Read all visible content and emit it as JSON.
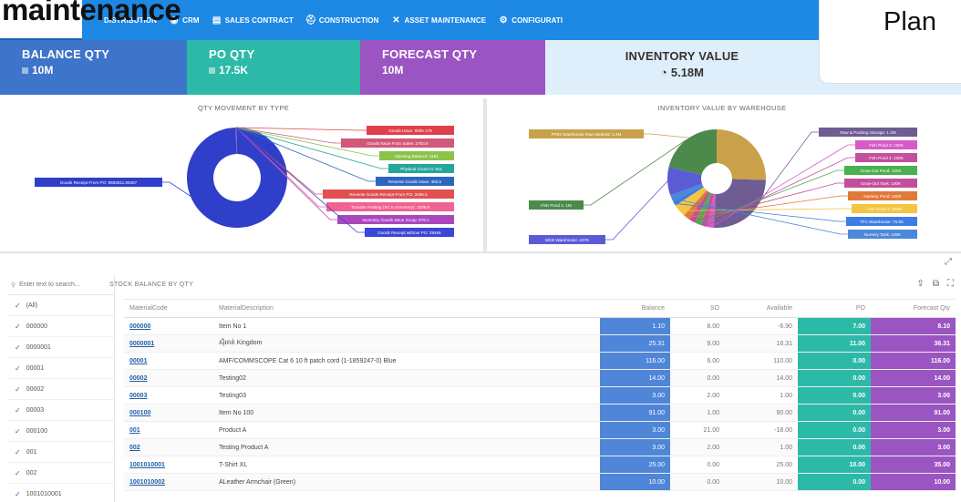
{
  "page_heading": "maintenance",
  "top_right_label": "Plan",
  "nav": {
    "items": [
      {
        "label": "DISTRIBUTION",
        "icon": "distribution-icon",
        "glyph": ""
      },
      {
        "label": "CRM",
        "icon": "crm-icon",
        "glyph": "◉"
      },
      {
        "label": "SALES CONTRACT",
        "icon": "document-icon",
        "glyph": "▤"
      },
      {
        "label": "CONSTRUCTION",
        "icon": "construction-worker-icon",
        "glyph": "⛑"
      },
      {
        "label": "ASSET MAINTENANCE",
        "icon": "tools-icon",
        "glyph": "✕"
      },
      {
        "label": "CONFIGURATI",
        "icon": "gears-icon",
        "glyph": "⚙"
      }
    ]
  },
  "kpis": {
    "balance": {
      "label": "BALANCE QTY",
      "value": "10M"
    },
    "po": {
      "label": "PO QTY",
      "value": "17.5K"
    },
    "forecast": {
      "label": "FORECAST QTY",
      "value": "10M"
    },
    "inventory": {
      "label": "INVENTORY VALUE",
      "value": "5.18M",
      "glyph": "◔"
    }
  },
  "charts": {
    "left_title": "QTY MOVEMENT BY TYPE",
    "right_title": "INVENTORY VALUE BY WAREHOUSE"
  },
  "chart_data": [
    {
      "type": "pie",
      "title": "QTY MOVEMENT BY TYPE",
      "slices": [
        {
          "label": "Goods Receipt From PO: 9992811.99367",
          "value": 9992811.99367,
          "color": "#2f3fc9"
        },
        {
          "label": "Goods Issue: 9005.179",
          "value": 9005.179,
          "color": "#e0404a"
        },
        {
          "label": "Goods Issue From Sales: 2753.9",
          "value": 2753.9,
          "color": "#d2587a"
        },
        {
          "label": "Opening Balance: 1181",
          "value": 1181,
          "color": "#8bc34a"
        },
        {
          "label": "Physical Count In: 911",
          "value": 911,
          "color": "#26a69a"
        },
        {
          "label": "Reverse Goods Issue: 455.5",
          "value": 455.5,
          "color": "#2e65c0"
        },
        {
          "label": "Reverse Goods Receipt From PO: 2056.5",
          "value": 2056.5,
          "color": "#e25050"
        },
        {
          "label": "Transfer Posting (SC In Inventory): 1009.8",
          "value": 1009.8,
          "color": "#f06292"
        },
        {
          "label": "Inventory Goods Issue Scrap: 679.1",
          "value": 679.1,
          "color": "#ab47bc"
        },
        {
          "label": "Goods Receipt without PO: 25465",
          "value": 25465,
          "color": "#3b46d6"
        }
      ]
    },
    {
      "type": "pie",
      "title": "INVENTORY VALUE BY WAREHOUSE",
      "slices": [
        {
          "label": "PP02 Warehouse Raw Material: 1.2M",
          "value": 1200000,
          "color": "#c9a14a"
        },
        {
          "label": "Raw & Packing Storage: 1.2M",
          "value": 1200000,
          "color": "#6e5c93"
        },
        {
          "label": "Fish Pond 3: 100K",
          "value": 100000,
          "color": "#d65ac8"
        },
        {
          "label": "Fish Pond 4: 100K",
          "value": 100000,
          "color": "#c24fa0"
        },
        {
          "label": "Grow-Out Pond: 100K",
          "value": 100000,
          "color": "#4caf50"
        },
        {
          "label": "Grow-Out Tank: 100K",
          "value": 100000,
          "color": "#c24f9b"
        },
        {
          "label": "Nursery Pond: 100K",
          "value": 100000,
          "color": "#e07a3a"
        },
        {
          "label": "Fish Pond 2: 200K",
          "value": 200000,
          "color": "#f4c542"
        },
        {
          "label": "TFC Warehouse: 75.6K",
          "value": 75600,
          "color": "#3b7de0"
        },
        {
          "label": "Nursery Tank: 100K",
          "value": 100000,
          "color": "#4a88d8"
        },
        {
          "label": "MCB Warehouse: 437K",
          "value": 437000,
          "color": "#5b5bd6"
        },
        {
          "label": "Fish Pond 1: 1M",
          "value": 1000000,
          "color": "#4b8a4b"
        }
      ]
    }
  ],
  "sidebar": {
    "search_placeholder": "Enter text to search...",
    "items": [
      "(All)",
      "000000",
      "0000001",
      "00001",
      "00002",
      "00003",
      "000100",
      "001",
      "002",
      "1001010001"
    ]
  },
  "table": {
    "title": "STOCK BALANCE BY QTY",
    "columns": [
      "MaterialCode",
      "MaterialDescription",
      "Balance",
      "SO",
      "Available",
      "PO",
      "Forecast Qty"
    ],
    "rows": [
      {
        "code": "000000",
        "desc": "Item No 1",
        "balance": "1.10",
        "so": "8.00",
        "available": "-6.90",
        "po": "7.00",
        "forecast": "8.10"
      },
      {
        "code": "0000001",
        "desc": "ស៊ុំអាត់ Kingdom",
        "balance": "25.31",
        "so": "9.00",
        "available": "16.31",
        "po": "11.00",
        "forecast": "36.31"
      },
      {
        "code": "00001",
        "desc": "AMF/COMMSCOPE Cat 6 10 ft patch cord (1-1859247-0) Blue",
        "balance": "116.00",
        "so": "6.00",
        "available": "110.00",
        "po": "0.00",
        "forecast": "116.00"
      },
      {
        "code": "00002",
        "desc": "Testing02",
        "balance": "14.00",
        "so": "0.00",
        "available": "14.00",
        "po": "0.00",
        "forecast": "14.00"
      },
      {
        "code": "00003",
        "desc": "Testing03",
        "balance": "3.00",
        "so": "2.00",
        "available": "1.00",
        "po": "0.00",
        "forecast": "3.00"
      },
      {
        "code": "000100",
        "desc": "Item No 100",
        "balance": "91.00",
        "so": "1.00",
        "available": "90.00",
        "po": "0.00",
        "forecast": "91.00"
      },
      {
        "code": "001",
        "desc": "Product A",
        "balance": "3.00",
        "so": "21.00",
        "available": "-18.00",
        "po": "0.00",
        "forecast": "3.00"
      },
      {
        "code": "002",
        "desc": "Testing Product A",
        "balance": "3.00",
        "so": "2.00",
        "available": "1.00",
        "po": "0.00",
        "forecast": "3.00"
      },
      {
        "code": "1001010001",
        "desc": "T-Shirt XL",
        "balance": "25.00",
        "so": "0.00",
        "available": "25.00",
        "po": "10.00",
        "forecast": "35.00"
      },
      {
        "code": "1001010002",
        "desc": "ALeather Armchair (Green)",
        "balance": "10.00",
        "so": "0.00",
        "available": "10.00",
        "po": "0.00",
        "forecast": "10.00"
      }
    ]
  }
}
